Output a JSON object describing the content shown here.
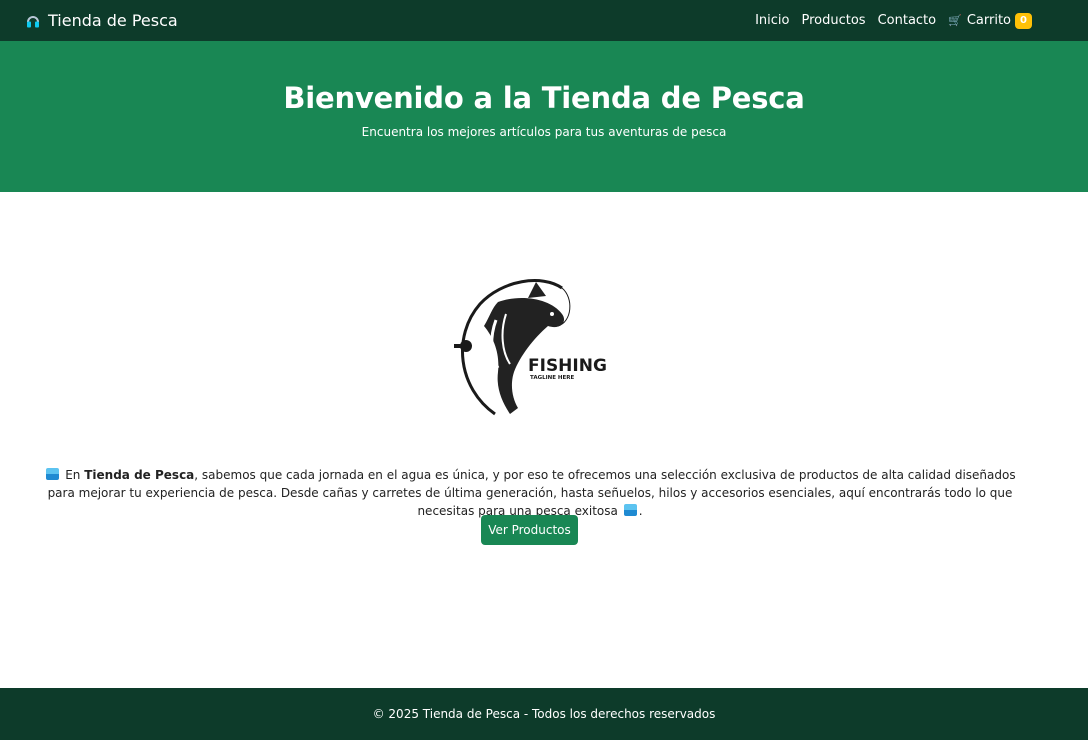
{
  "navbar": {
    "brand": "Tienda de Pesca",
    "links": [
      "Inicio",
      "Productos",
      "Contacto"
    ],
    "cart_label": "Carrito",
    "cart_count": "0"
  },
  "hero": {
    "title": "Bienvenido a la Tienda de Pesca",
    "subtitle": "Encuentra los mejores artículos para tus aventuras de pesca"
  },
  "logo": {
    "word": "FISHING",
    "tagline": "TAGLINE HERE"
  },
  "intro": {
    "before": "En ",
    "brand": "Tienda de Pesca",
    "text": ", sabemos que cada jornada en el agua es única, y por eso te ofrecemos una selección exclusiva de productos de alta calidad diseñados para mejorar tu experiencia de pesca. Desde cañas y carretes de última generación, hasta señuelos, hilos y accesorios esenciales, aquí encontrarás todo lo que necesitas para una pesca exitosa",
    "end": "."
  },
  "cta_label": "Ver Productos",
  "footer": "© 2025 Tienda de Pesca - Todos los derechos reservados",
  "colors": {
    "nav_bg": "#0d3b2a",
    "hero_bg": "#198754",
    "badge": "#ffc107"
  },
  "icons": {
    "brand": "headphones-icon",
    "cart": "shopping-cart-icon",
    "emoji": "water-emoji-icon"
  }
}
